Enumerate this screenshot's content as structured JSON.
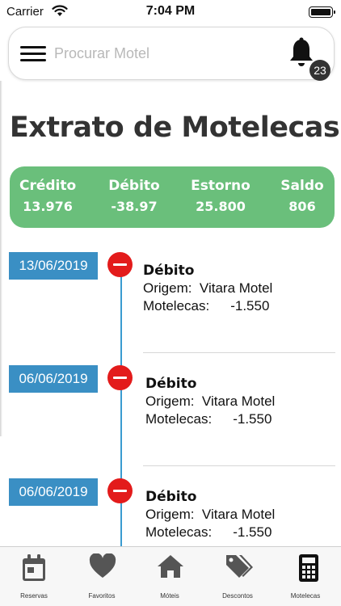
{
  "status_bar": {
    "carrier": "Carrier",
    "time": "7:04 PM"
  },
  "header": {
    "search_placeholder": "Procurar Motel",
    "notification_count": "23"
  },
  "page_title": "Extrato de Motelecas",
  "summary": {
    "color": "#6abf7b",
    "items": [
      {
        "label": "Crédito",
        "value": "13.976"
      },
      {
        "label": "Débito",
        "value": "-38.97"
      },
      {
        "label": "Estorno",
        "value": "25.800"
      },
      {
        "label": "Saldo",
        "value": "806"
      }
    ]
  },
  "transactions": [
    {
      "date": "13/06/2019",
      "type": "Débito",
      "origin_label": "Origem:",
      "origin": "Vitara Motel",
      "amount_label": "Motelecas:",
      "amount": "-1.550"
    },
    {
      "date": "06/06/2019",
      "type": "Débito",
      "origin_label": "Origem:",
      "origin": "Vitara Motel",
      "amount_label": "Motelecas:",
      "amount": "-1.550"
    },
    {
      "date": "06/06/2019",
      "type": "Débito",
      "origin_label": "Origem:",
      "origin": "Vitara Motel",
      "amount_label": "Motelecas:",
      "amount": "-1.550"
    }
  ],
  "tabs": [
    {
      "label": "Reservas",
      "icon": "calendar-icon"
    },
    {
      "label": "Favoritos",
      "icon": "heart-icon"
    },
    {
      "label": "Móteis",
      "icon": "home-icon"
    },
    {
      "label": "Descontos",
      "icon": "tags-icon"
    },
    {
      "label": "Motelecas",
      "icon": "calculator-icon"
    }
  ],
  "colors": {
    "accent_blue": "#3a8fc4",
    "debit_red": "#e31b1b",
    "title_gray": "#333333"
  }
}
